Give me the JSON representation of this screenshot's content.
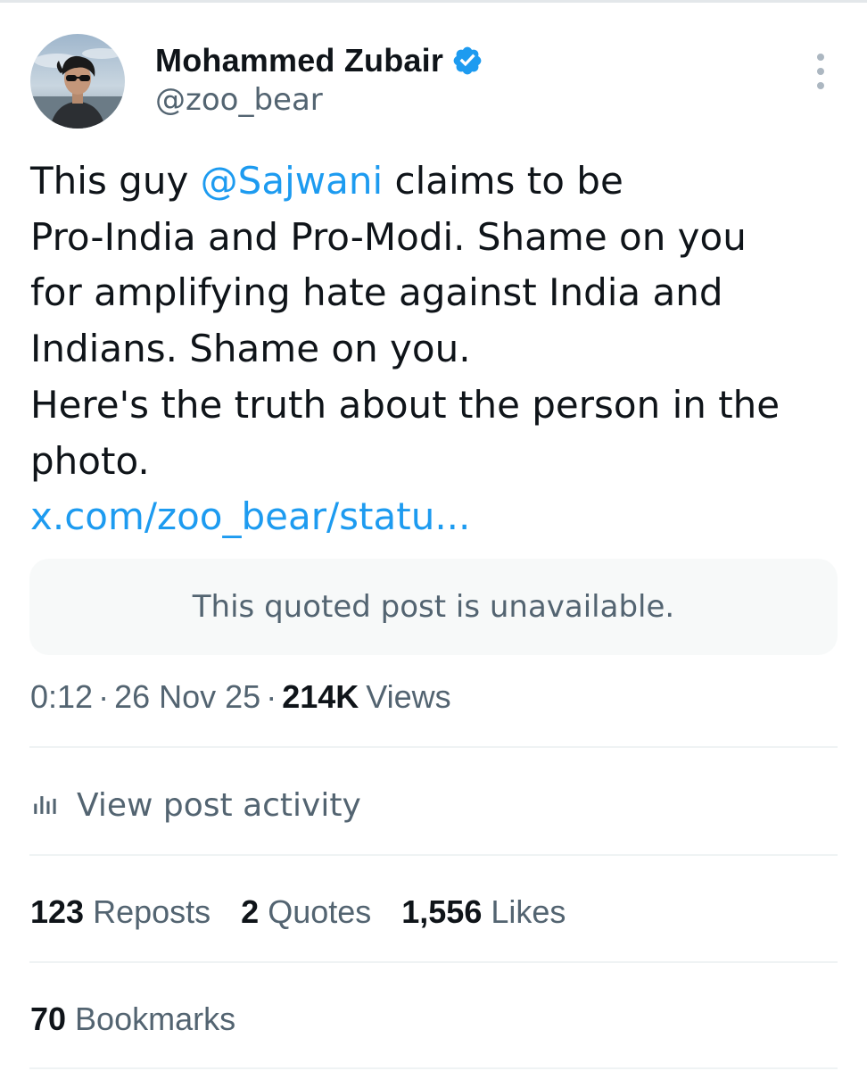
{
  "author": {
    "name": "Mohammed Zubair",
    "handle": "@zoo_bear",
    "verified": true,
    "verified_icon": "verified-badge-icon",
    "avatar_icon": "avatar"
  },
  "tweet": {
    "line1": {
      "before": "This guy ",
      "mention": "@Sajwani",
      "after": " claims to be"
    },
    "line2": "Pro-India and Pro-Modi. Shame on you",
    "line3": "for amplifying hate against India and",
    "line4": "Indians. Shame on you.",
    "line5": "Here's the truth about the person in the",
    "line6": "photo.",
    "link": "x.com/zoo_bear/statu..."
  },
  "quoted_post": {
    "message": "This quoted post is unavailable."
  },
  "meta": {
    "time": "0:12",
    "separator": "·",
    "date": "26 Nov 25",
    "views_count": "214K",
    "views_label": "Views"
  },
  "activity": {
    "icon": "analytics-bars-icon",
    "label": "View post activity"
  },
  "stats": {
    "reposts": {
      "count": "123",
      "label": "Reposts"
    },
    "quotes": {
      "count": "2",
      "label": "Quotes"
    },
    "likes": {
      "count": "1,556",
      "label": "Likes"
    },
    "bookmarks": {
      "count": "70",
      "label": "Bookmarks"
    }
  },
  "colors": {
    "link": "#1d9bf0",
    "text_primary": "#0f1419",
    "text_secondary": "#536471",
    "verified_badge": "#1d9bf0",
    "divider": "#eff3f4",
    "quoted_bg": "#f7f9f9"
  }
}
